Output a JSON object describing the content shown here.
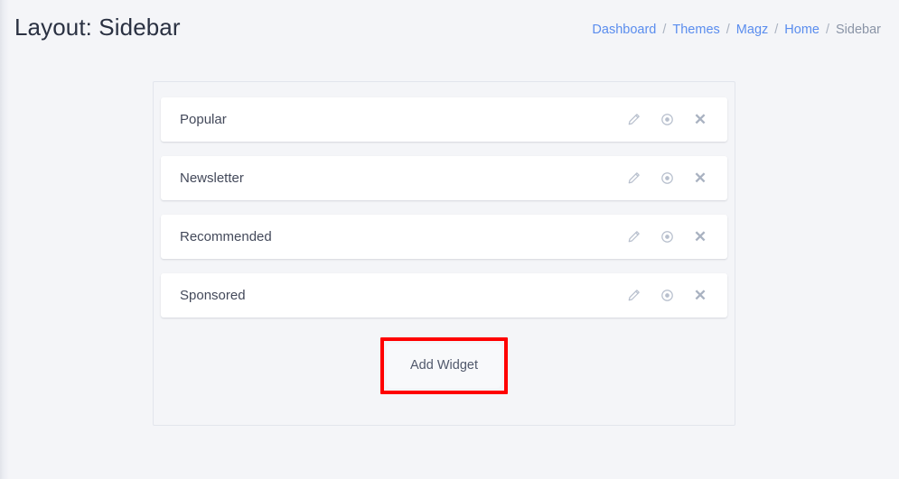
{
  "header": {
    "title": "Layout: Sidebar",
    "breadcrumb": [
      {
        "label": "Dashboard",
        "current": false
      },
      {
        "label": "Themes",
        "current": false
      },
      {
        "label": "Magz",
        "current": false
      },
      {
        "label": "Home",
        "current": false
      },
      {
        "label": "Sidebar",
        "current": true
      }
    ],
    "breadcrumb_separator": "/"
  },
  "widgets": {
    "items": [
      {
        "name": "Popular"
      },
      {
        "name": "Newsletter"
      },
      {
        "name": "Recommended"
      },
      {
        "name": "Sponsored"
      }
    ],
    "row_actions": {
      "edit": "edit-pencil-icon",
      "view": "eye-icon",
      "remove": "close-x-icon",
      "remove_glyph": "✕"
    }
  },
  "actions": {
    "add_widget_label": "Add Widget",
    "highlight_color": "#ff0000"
  },
  "colors": {
    "page_background": "#f4f5f8",
    "card_background": "#ffffff",
    "panel_border": "#e2e5ec",
    "link": "#5a8dee",
    "title_text": "#2a3142",
    "muted_text": "#8a94a6",
    "icon": "#b7bfcd"
  }
}
